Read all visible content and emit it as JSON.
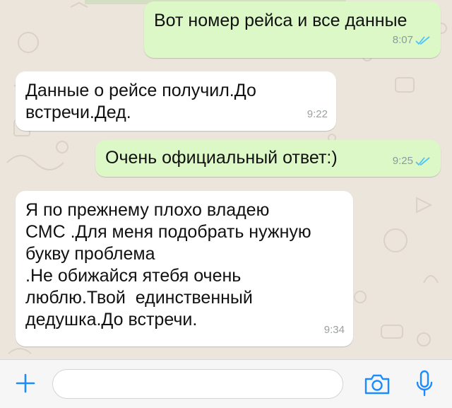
{
  "messages": [
    {
      "direction": "out",
      "text": "Вот номер рейса и все данные",
      "time": "8:07",
      "read": true
    },
    {
      "direction": "in",
      "text": "Данные о рейсе получил.До\nвстречи.Дед.",
      "time": "9:22"
    },
    {
      "direction": "out",
      "text": "Очень официальный ответ:)",
      "time": "9:25",
      "read": true
    },
    {
      "direction": "in",
      "text": "Я по прежнему плохо владею\nСМС .Для меня подобрать нужную\nбукву проблема\n.Не обижайся ятебя очень\nлюблю.Твой  единственный\nдедушка.До встречи.",
      "time": "9:34"
    }
  ],
  "composer": {
    "placeholder": "",
    "icons": [
      "plus-icon",
      "camera-icon",
      "microphone-icon"
    ]
  },
  "colors": {
    "accent": "#1a8cff",
    "outgoing_bubble": "#dcf8c6",
    "incoming_bubble": "#ffffff",
    "read_ticks": "#4fc3f7",
    "chat_background": "#ece5dc"
  }
}
